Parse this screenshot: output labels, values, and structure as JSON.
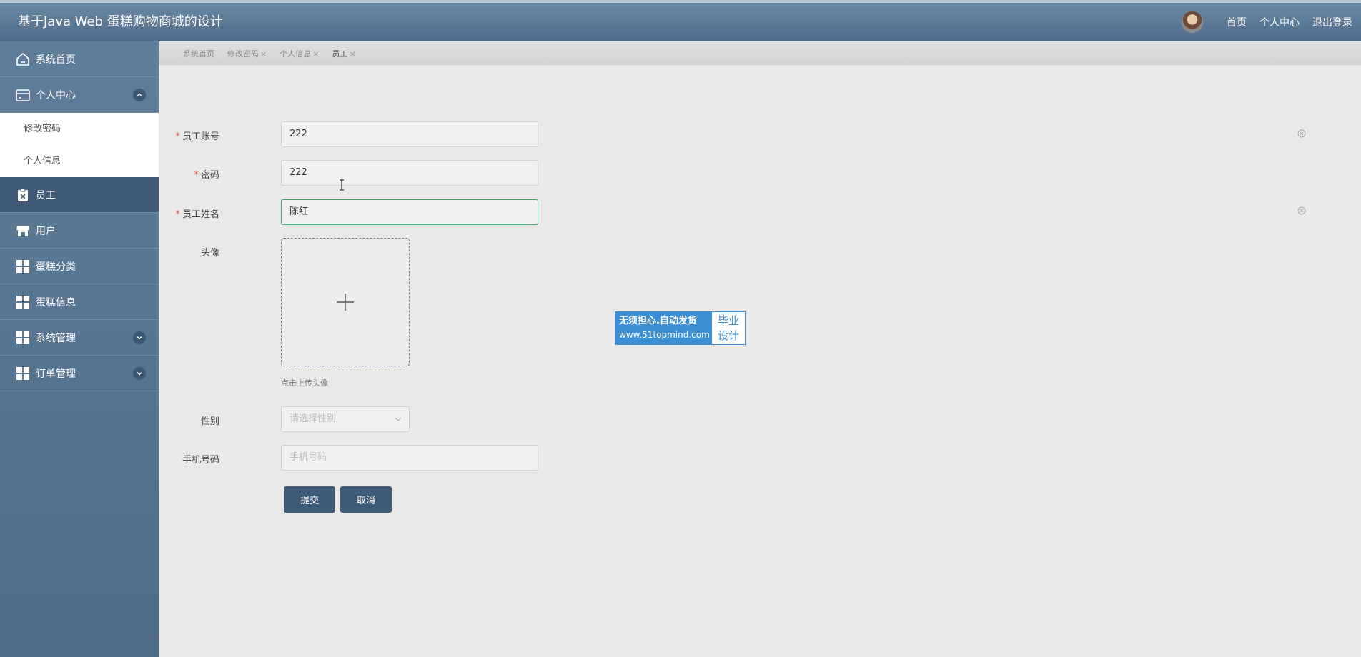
{
  "header": {
    "title": "基于Java Web 蛋糕购物商城的设计",
    "links": [
      "首页",
      "个人中心",
      "退出登录"
    ]
  },
  "sidebar": {
    "items": [
      {
        "label": "系统首页",
        "icon": "home-icon"
      },
      {
        "label": "个人中心",
        "icon": "wallet-icon",
        "expanded": true,
        "children": [
          "修改密码",
          "个人信息"
        ]
      },
      {
        "label": "员工",
        "icon": "clipboard-icon",
        "active": true
      },
      {
        "label": "用户",
        "icon": "store-icon"
      },
      {
        "label": "蛋糕分类",
        "icon": "grid-icon"
      },
      {
        "label": "蛋糕信息",
        "icon": "grid-icon"
      },
      {
        "label": "系统管理",
        "icon": "grid-icon",
        "expanded": false
      },
      {
        "label": "订单管理",
        "icon": "grid-icon",
        "expanded": false
      }
    ]
  },
  "tabs": [
    {
      "label": "系统首页",
      "closable": false
    },
    {
      "label": "修改密码",
      "closable": true
    },
    {
      "label": "个人信息",
      "closable": true
    },
    {
      "label": "员工",
      "closable": true,
      "current": true
    }
  ],
  "tab_close_glyph": "×",
  "form": {
    "account": {
      "label": "员工账号",
      "required": true,
      "value": "222"
    },
    "password": {
      "label": "密码",
      "required": true,
      "value": "222"
    },
    "name": {
      "label": "员工姓名",
      "required": true,
      "value": "陈红"
    },
    "avatar": {
      "label": "头像",
      "tip": "点击上传头像"
    },
    "gender": {
      "label": "性别",
      "placeholder": "请选择性别"
    },
    "phone": {
      "label": "手机号码",
      "placeholder": "手机号码"
    },
    "submit_label": "提交",
    "cancel_label": "取消"
  },
  "required_mark": "*",
  "watermark": {
    "line1": "无须担心.自动发货",
    "line2": "www.51topmind.com",
    "right1": "毕业",
    "right2": "设计"
  },
  "colors": {
    "header": "#56748f",
    "sidebar": "#58768f",
    "sidebar_active": "#3f5a77",
    "button": "#3f5b78",
    "focus_border": "#3aaa6c",
    "required": "#e06060",
    "badge": "#3d8fd3"
  }
}
